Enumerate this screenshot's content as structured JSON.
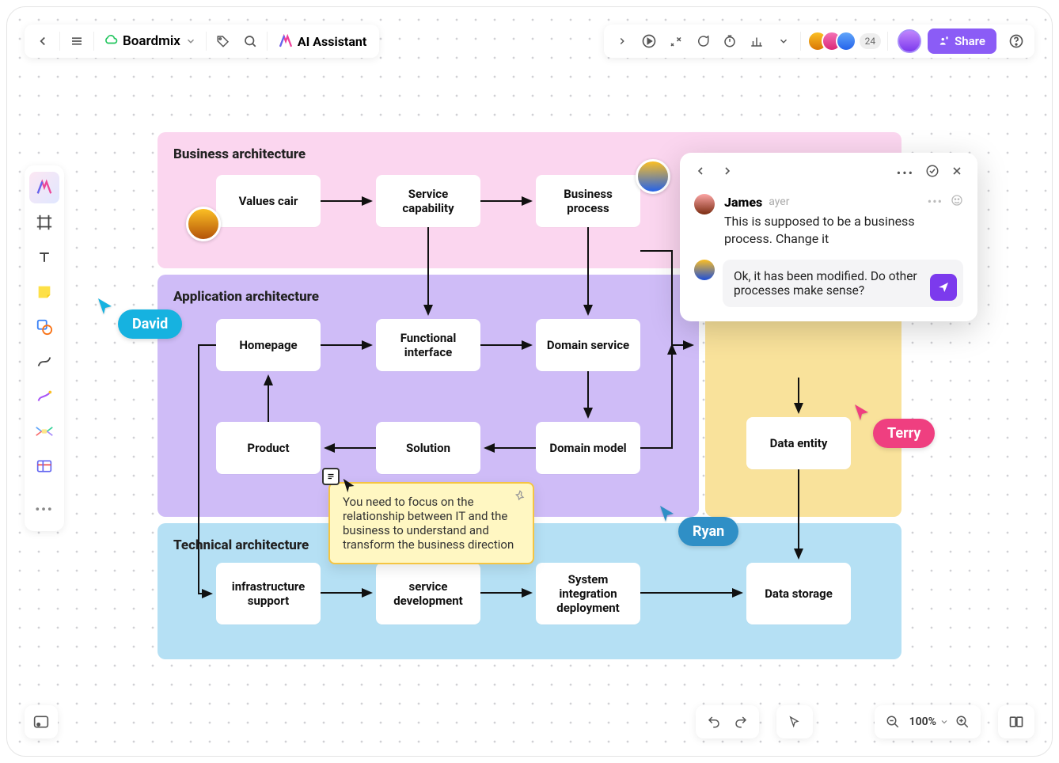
{
  "header": {
    "board_name": "Boardmix",
    "ai_label": "AI Assistant",
    "avatar_count": "24",
    "share_label": "Share"
  },
  "sidebar_tools": [
    "select-tool",
    "frame-tool",
    "text-tool",
    "sticky-note-tool",
    "shape-tool",
    "connector-tool",
    "pen-tool",
    "mindmap-tool",
    "table-tool"
  ],
  "zoom": {
    "value": "100%"
  },
  "sections": {
    "business": {
      "title": "Business architecture",
      "nodes": [
        "Values cair",
        "Service capability",
        "Business process"
      ]
    },
    "application": {
      "title": "Application architecture",
      "nodes": [
        "Homepage",
        "Functional interface",
        "Domain service",
        "Product",
        "Solution",
        "Domain model"
      ]
    },
    "data": {
      "title": "",
      "nodes": [
        "Data entity"
      ]
    },
    "technical": {
      "title": "Technical architecture",
      "nodes": [
        "infrastructure support",
        "service development",
        "System integration deployment",
        "Data storage"
      ]
    }
  },
  "cursors": {
    "david": "David",
    "ryan": "Ryan",
    "terry": "Terry"
  },
  "sticky": {
    "text": "You need to focus on the relationship between IT and the business to understand and transform the business direction"
  },
  "comments": {
    "author": "James",
    "time": "ayer",
    "text": "This is supposed to be a business process. Change it",
    "reply": "Ok, it has been modified. Do other processes make sense?"
  }
}
